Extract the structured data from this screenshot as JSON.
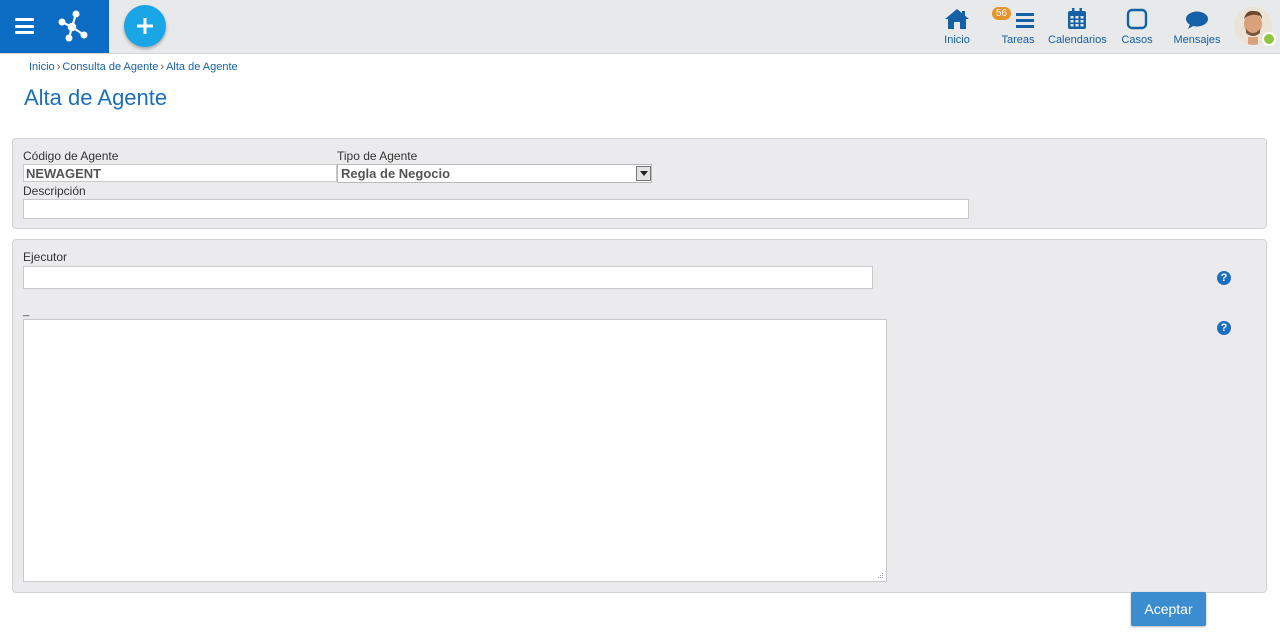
{
  "nav": {
    "items": [
      {
        "label": "Inicio",
        "icon": "home-icon"
      },
      {
        "label": "Tareas",
        "icon": "tasks-icon",
        "badge": "56"
      },
      {
        "label": "Calendarios",
        "icon": "calendar-icon"
      },
      {
        "label": "Casos",
        "icon": "cases-icon"
      },
      {
        "label": "Mensajes",
        "icon": "messages-icon"
      }
    ]
  },
  "breadcrumb": {
    "items": [
      "Inicio",
      "Consulta de Agente",
      "Alta de Agente"
    ],
    "separator": "›"
  },
  "page_title": "Alta de Agente",
  "form": {
    "codigo_label": "Código de Agente",
    "codigo_value": "NEWAGENT",
    "tipo_label": "Tipo de Agente",
    "tipo_value": "Regla de Negocio",
    "descripcion_label": "Descripción",
    "descripcion_value": "",
    "ejecutor_label": "Ejecutor",
    "ejecutor_value": "",
    "textarea_label": "_",
    "textarea_value": "",
    "help_glyph": "?"
  },
  "actions": {
    "accept_label": "Aceptar"
  },
  "colors": {
    "brand_blue": "#0a6cc2",
    "accent_cyan": "#1aa6e6",
    "badge_orange": "#e8932a",
    "online_green": "#8cc63f"
  }
}
